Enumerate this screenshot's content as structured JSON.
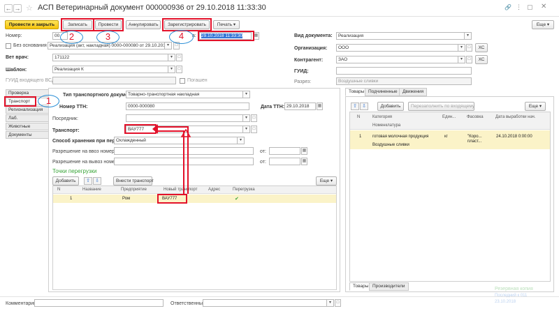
{
  "window": {
    "title": "АСП Ветеринарный документ 000000936 от 29.10.2018 11:33:30"
  },
  "toolbar": {
    "post_close": "Провести и закрыть",
    "save": "Записать",
    "post": "Провести",
    "cancel": "Аннулировать",
    "register": "Зарегистрировать",
    "print": "Печать",
    "more": "Еще"
  },
  "header": {
    "number_label": "Номер:",
    "number_value": "00",
    "date_label": "а:",
    "date_value": "29.10.2018 11:33:30",
    "basis_label": "Без основания",
    "basis_value": "Реализация (акт, накладная) 0000-000080 от 29.10.2018 1",
    "vet_label": "Вет врач:",
    "vet_value": "171122",
    "template_label": "Шаблон:",
    "template_value": "Реализация К",
    "guid_in_label": "ГУИД входящего ВСД:",
    "repaid_label": "Погашен",
    "doctype_label": "Вид документа:",
    "doctype_value": "Реализация",
    "org_label": "Организация:",
    "org_value": "ООО",
    "contractor_label": "Контрагент:",
    "contractor_value": "ЗАО",
    "guid_label": "ГУИД:",
    "guid_value": "",
    "section_label": "Разрез:",
    "section_value": "Воздушные слив​ки",
    "xc": "ХС"
  },
  "side_tabs": [
    "Проверка",
    "Транспорт",
    "Регионализация",
    "Лаб. исследования",
    "Животные",
    "Документы"
  ],
  "transport": {
    "doc_type_label": "Тип транспортного документа:",
    "doc_type_value": "Товарно-транспортная накладная",
    "ttn_number_label": "Номер ТТН:",
    "ttn_number_value": "0000-000080",
    "ttn_date_label": "Дата ТТН:",
    "ttn_date_value": "29.10.2018",
    "intermediary_label": "Посредник:",
    "transport_label": "Транспорт:",
    "transport_value": "ВАУ777",
    "storage_label": "Способ хранения при перевозке:",
    "storage_value": "Охлажденный",
    "import_label": "Разрешение на ввоз номер",
    "export_label": "Разрешение на вывоз номер",
    "from_label": "от:"
  },
  "reload": {
    "title": "Точки перегрузки",
    "add": "Добавить",
    "enter_transport": "Внести транспорт",
    "more": "Еще",
    "columns": [
      "N",
      "Название",
      "Предприятие",
      "Новый транспорт",
      "Адрес",
      "Перегрузка"
    ],
    "rows": [
      {
        "n": "1",
        "name": "",
        "enterprise": "Ром",
        "new_transport": "ВАУ777",
        "address": "",
        "reload": "✔"
      }
    ]
  },
  "right_panel": {
    "tabs": [
      "Товары",
      "Подчиненные",
      "Движения"
    ],
    "add": "Добавить",
    "refill": "Перезаполнить по входящему",
    "more": "Еще",
    "columns": [
      "N",
      "Категория",
      "Един...",
      "Фасовка",
      "Дата выработки нач."
    ],
    "sub_column": "Номенклатура",
    "rows": [
      {
        "n": "1",
        "category": "готовая молочная продукция",
        "nomenclature": "Воздушные слив​ки",
        "unit": "кг",
        "pack": "\"Коро... пласт...",
        "date": "24.10.2018 0:00:00"
      }
    ],
    "bottom_tabs": [
      "Товары",
      "Производители"
    ]
  },
  "footer": {
    "comment_label": "Комментарий:",
    "responsible_label": "Ответственный:"
  },
  "watermark": {
    "line1": "Резервная копия",
    "line2": "Последний к 011",
    "line3": "23.10.2018"
  },
  "annotations": {
    "c1": "1",
    "c2": "2",
    "c3": "3",
    "c4": "4"
  },
  "colors": {
    "accent_yellow": "#f5c20a",
    "highlight_red": "#e3112a",
    "circle_blue": "#2a8ed6",
    "row_selected": "#fbf3c8",
    "green_title": "#3aa53a"
  }
}
